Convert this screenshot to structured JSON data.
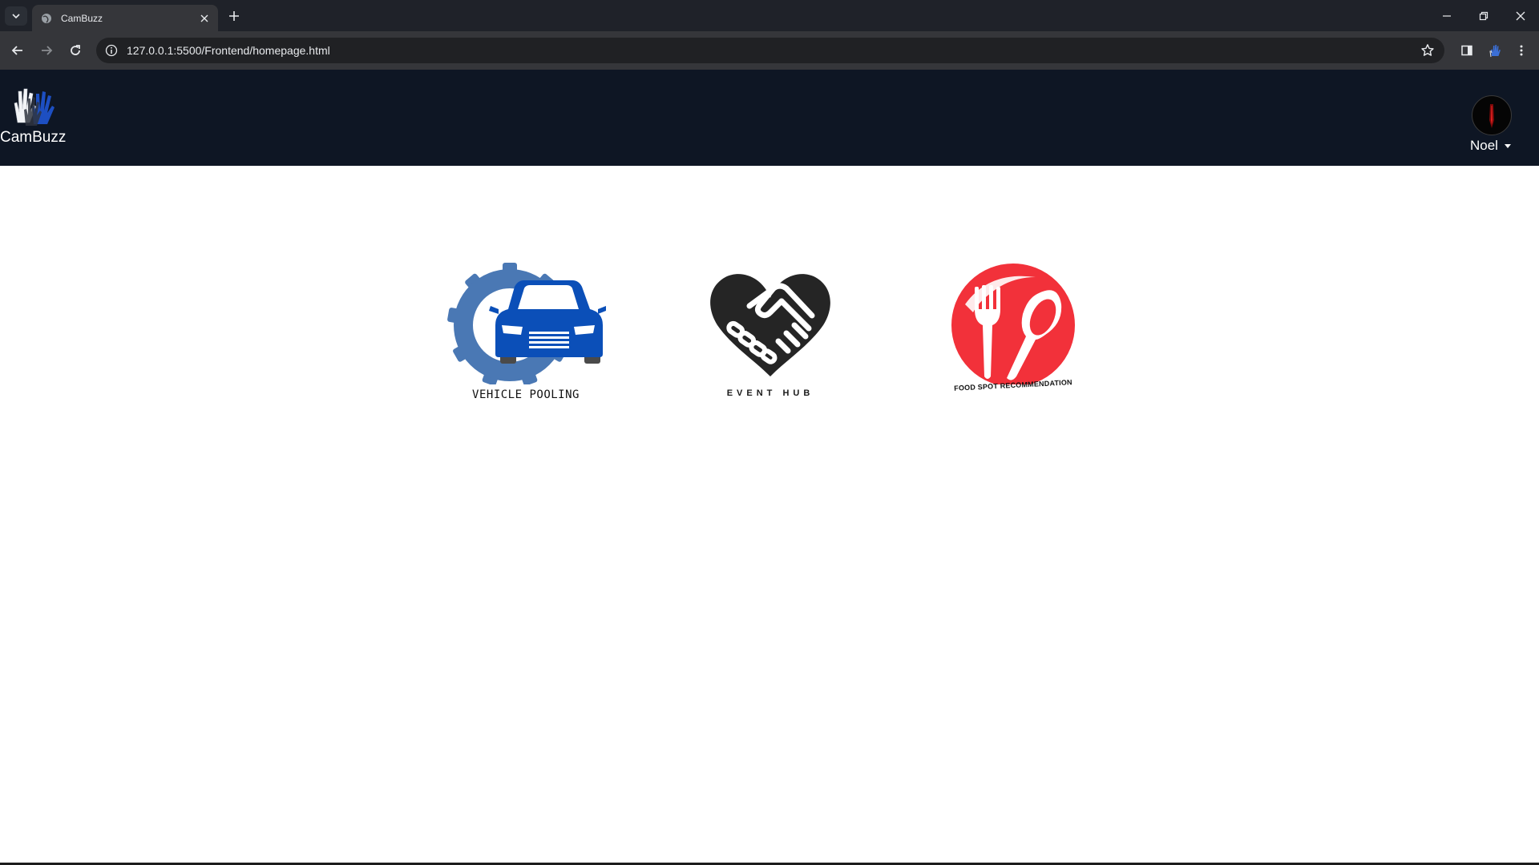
{
  "browser": {
    "tab_title": "CamBuzz",
    "url": "127.0.0.1:5500/Frontend/homepage.html"
  },
  "header": {
    "brand_name": "CamBuzz",
    "user_name": "Noel"
  },
  "services": [
    {
      "label": "VEHICLE POOLING",
      "icon": "car-gear-icon",
      "color": "#0b4fb8"
    },
    {
      "label": "EVENT HUB",
      "icon": "handshake-heart-icon",
      "color": "#252525"
    },
    {
      "label": "FOOD SPOT RECOMMENDATION",
      "icon": "fork-spoon-icon",
      "color": "#f2313a"
    }
  ],
  "colors": {
    "header_bg": "#0e1624",
    "gear": "#4a78b4",
    "car": "#0b4fb8",
    "food_red": "#f2313a"
  }
}
